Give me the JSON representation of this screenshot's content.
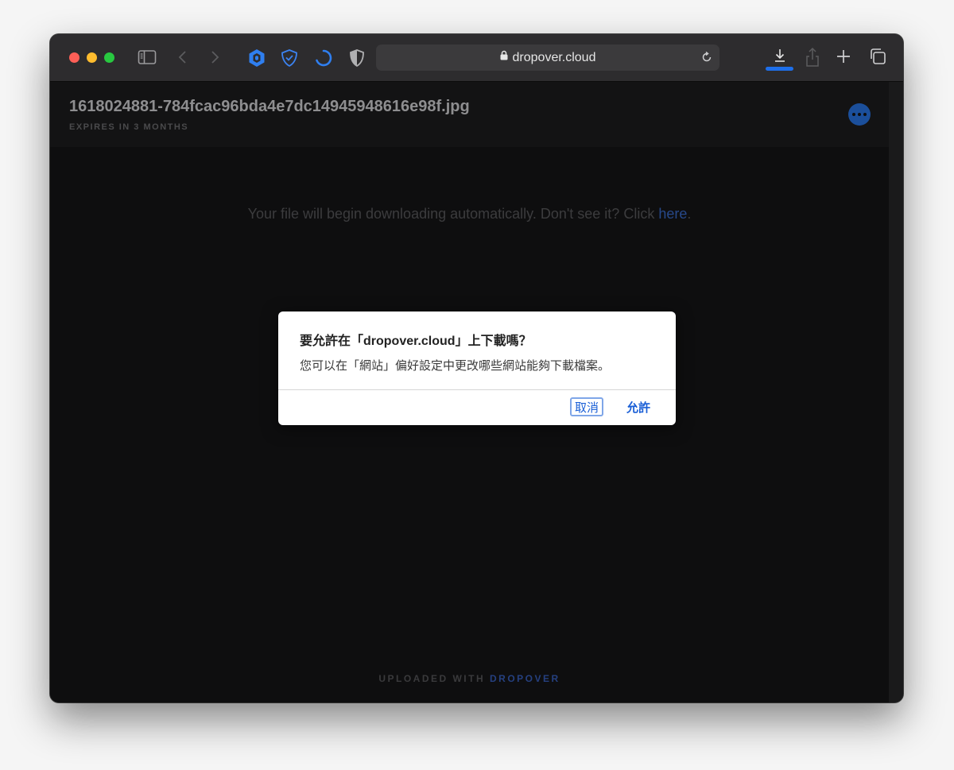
{
  "browser": {
    "url": "dropover.cloud",
    "colors": {
      "accent": "#1e6fea",
      "toolbar": "#2d2c2e"
    },
    "toolbar_icons": [
      "sidebar-icon",
      "back-icon",
      "forward-icon",
      "extension-hex-icon",
      "shield-check-icon",
      "loading-spinner-icon",
      "privacy-shield-icon",
      "lock-icon",
      "reload-icon",
      "download-icon",
      "share-icon",
      "new-tab-icon",
      "tabs-overview-icon"
    ]
  },
  "page": {
    "filename": "1618024881-784fcac96bda4e7dc14945948616e98f.jpg",
    "expires": "EXPIRES IN 3 MONTHS",
    "message_prefix": "Your file will begin downloading automatically. Don't see it? Click ",
    "message_link": "here",
    "message_suffix": ".",
    "footer_prefix": "UPLOADED WITH ",
    "footer_brand": "DROPOVER"
  },
  "dialog": {
    "title": "要允許在「dropover.cloud」上下載嗎？",
    "message": "您可以在「網站」偏好設定中更改哪些網站能夠下載檔案。",
    "cancel_label": "取消",
    "allow_label": "允許"
  }
}
